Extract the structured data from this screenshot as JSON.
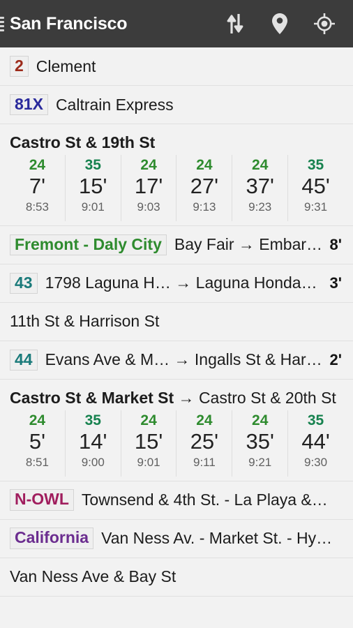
{
  "actionbar": {
    "menu_icon": "hamburger-icon",
    "title": "San Francisco",
    "icons": [
      {
        "name": "sort-updown-icon",
        "label": "Sort"
      },
      {
        "name": "map-pin-icon",
        "label": "Map"
      },
      {
        "name": "my-location-icon",
        "label": "My location"
      }
    ]
  },
  "colors": {
    "accent_green": "#2e8b2e",
    "accent_green_dark": "#17824f",
    "badge_red": "#9c2a1a",
    "badge_blue": "#2a2a9c",
    "badge_teal": "#1a7a7a",
    "badge_magenta": "#a01e5e",
    "badge_purple": "#6b2d8f",
    "actionbar_bg": "#3c3c3c",
    "page_bg": "#f2f2f2"
  },
  "list": [
    {
      "kind": "route",
      "name": "route-row-2-clement",
      "badge": "2",
      "badge_color": "#9c2a1a",
      "badge_bold": true,
      "text": "Clement",
      "eta": ""
    },
    {
      "kind": "route",
      "name": "route-row-81x-caltrain-express",
      "badge": "81X",
      "badge_color": "#2a2a9c",
      "badge_bold": true,
      "text": "Caltrain Express",
      "eta": ""
    },
    {
      "kind": "departures",
      "name": "departures-castro-19th",
      "title_bold": "Castro St & 19th St",
      "title_rest": "",
      "departures": [
        {
          "line": "24",
          "line_color": "#2e8b2e",
          "minutes": "7'",
          "clock": "8:53"
        },
        {
          "line": "35",
          "line_color": "#17824f",
          "minutes": "15'",
          "clock": "9:01"
        },
        {
          "line": "24",
          "line_color": "#2e8b2e",
          "minutes": "17'",
          "clock": "9:03"
        },
        {
          "line": "24",
          "line_color": "#2e8b2e",
          "minutes": "27'",
          "clock": "9:13"
        },
        {
          "line": "24",
          "line_color": "#2e8b2e",
          "minutes": "37'",
          "clock": "9:23"
        },
        {
          "line": "35",
          "line_color": "#17824f",
          "minutes": "45'",
          "clock": "9:31"
        }
      ]
    },
    {
      "kind": "route",
      "name": "route-row-fremont-daly-city",
      "badge": "Fremont - Daly City",
      "badge_color": "#2e8b2e",
      "badge_bold": true,
      "text": "Bay Fair → Embar…",
      "eta": "8'"
    },
    {
      "kind": "route",
      "name": "route-row-43",
      "badge": "43",
      "badge_color": "#1a7a7a",
      "badge_bold": true,
      "text": "1798 Laguna H… → Laguna Honda…",
      "eta": "3'"
    },
    {
      "kind": "stop",
      "name": "stop-row-11th-harrison",
      "badge": "",
      "badge_color": "",
      "badge_bold": false,
      "text": "11th St & Harrison St",
      "eta": ""
    },
    {
      "kind": "route",
      "name": "route-row-44",
      "badge": "44",
      "badge_color": "#1a7a7a",
      "badge_bold": true,
      "text": "Evans Ave & M… → Ingalls St & Har…",
      "eta": "2'"
    },
    {
      "kind": "departures",
      "name": "departures-castro-market",
      "title_bold": "Castro St & Market St",
      "title_rest": " → Castro St & 20th St",
      "departures": [
        {
          "line": "24",
          "line_color": "#2e8b2e",
          "minutes": "5'",
          "clock": "8:51"
        },
        {
          "line": "35",
          "line_color": "#17824f",
          "minutes": "14'",
          "clock": "9:00"
        },
        {
          "line": "24",
          "line_color": "#2e8b2e",
          "minutes": "15'",
          "clock": "9:01"
        },
        {
          "line": "24",
          "line_color": "#2e8b2e",
          "minutes": "25'",
          "clock": "9:11"
        },
        {
          "line": "24",
          "line_color": "#2e8b2e",
          "minutes": "35'",
          "clock": "9:21"
        },
        {
          "line": "35",
          "line_color": "#17824f",
          "minutes": "44'",
          "clock": "9:30"
        }
      ]
    },
    {
      "kind": "route",
      "name": "route-row-n-owl",
      "badge": "N-OWL",
      "badge_color": "#a01e5e",
      "badge_bold": true,
      "text": "Townsend & 4th St. - La Playa &…",
      "eta": ""
    },
    {
      "kind": "route",
      "name": "route-row-california",
      "badge": "California",
      "badge_color": "#6b2d8f",
      "badge_bold": true,
      "text": "Van Ness Av. - Market St. - Hy…",
      "eta": ""
    },
    {
      "kind": "stop",
      "name": "stop-row-van-ness-bay",
      "badge": "",
      "badge_color": "",
      "badge_bold": false,
      "text": "Van Ness Ave & Bay St",
      "eta": ""
    }
  ]
}
